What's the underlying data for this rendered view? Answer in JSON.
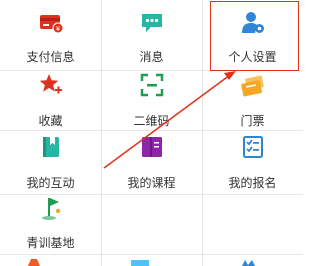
{
  "grid": {
    "items": [
      {
        "label": "支付信息",
        "icon": "payment-card-icon"
      },
      {
        "label": "消息",
        "icon": "message-bubble-icon"
      },
      {
        "label": "个人设置",
        "icon": "user-settings-icon"
      },
      {
        "label": "收藏",
        "icon": "star-plus-icon"
      },
      {
        "label": "二维码",
        "icon": "qr-code-icon"
      },
      {
        "label": "门票",
        "icon": "ticket-icon"
      },
      {
        "label": "我的互动",
        "icon": "bookmark-book-icon"
      },
      {
        "label": "我的课程",
        "icon": "course-book-icon"
      },
      {
        "label": "我的报名",
        "icon": "registration-list-icon"
      },
      {
        "label": "青训基地",
        "icon": "golf-flag-icon"
      }
    ]
  },
  "colors": {
    "red": "#e0301e",
    "teal": "#27b6a3",
    "blue": "#2f86d6",
    "green": "#1f9d55",
    "orange": "#f5a623",
    "purple": "#8e24aa",
    "annotation": "#e0301e"
  }
}
